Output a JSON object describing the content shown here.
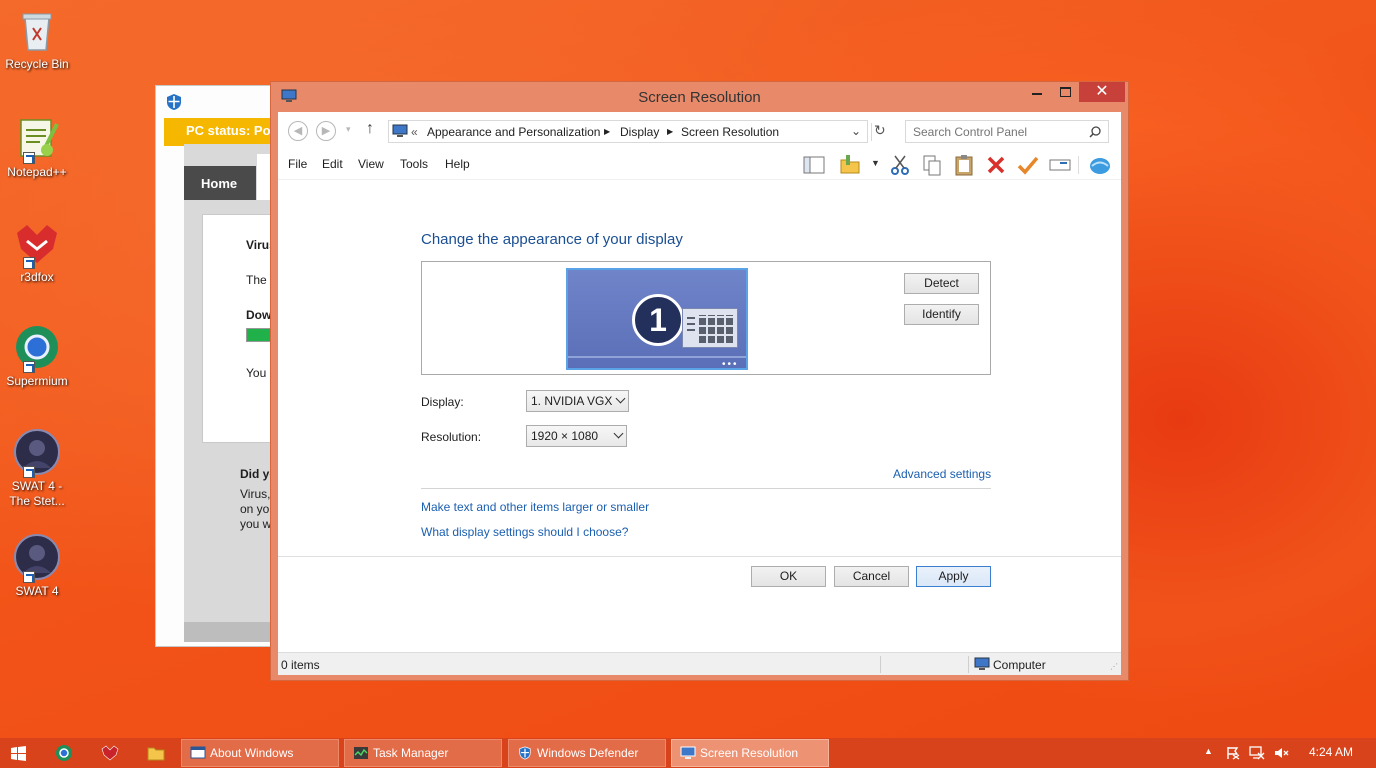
{
  "desktop": {
    "icons": [
      {
        "label": "Recycle Bin",
        "icon": "recycle-bin-icon"
      },
      {
        "label": "Notepad++",
        "icon": "notepad-plus-plus-icon"
      },
      {
        "label": "r3dfox",
        "icon": "r3dfox-icon"
      },
      {
        "label": "Supermium",
        "icon": "supermium-icon"
      },
      {
        "label": "SWAT 4 - The Stet...",
        "label_line1": "SWAT 4 -",
        "label_line2": "The Stet...",
        "icon": "swat4-icon"
      },
      {
        "label": "SWAT 4",
        "icon": "swat4-icon"
      }
    ]
  },
  "defender": {
    "status": "PC status: Pot",
    "home_tab": "Home",
    "texts": [
      "Virus",
      "The",
      "Dow",
      "You",
      "Did yo",
      "Virus,",
      "on yo",
      "you w"
    ]
  },
  "window": {
    "title": "Screen Resolution",
    "close_glyph": "✕",
    "address": {
      "prefix": "«",
      "crumbs": [
        "Appearance and Personalization",
        "Display",
        "Screen Resolution"
      ]
    },
    "search_placeholder": "Search Control Panel",
    "menu": [
      "File",
      "Edit",
      "View",
      "Tools",
      "Help"
    ],
    "heading": "Change the appearance of your display",
    "monitor_number": "1",
    "detect_label": "Detect",
    "identify_label": "Identify",
    "display_label": "Display:",
    "display_value": "1. NVIDIA VGX",
    "resolution_label": "Resolution:",
    "resolution_value": "1920 × 1080",
    "advanced_link": "Advanced settings",
    "link_text_size": "Make text and other items larger or smaller",
    "link_display_settings": "What display settings should I choose?",
    "ok_label": "OK",
    "cancel_label": "Cancel",
    "apply_label": "Apply",
    "status_items": "0 items",
    "status_computer": "Computer"
  },
  "taskbar": {
    "tasks": [
      "About Windows",
      "Task Manager",
      "Windows Defender",
      "Screen Resolution"
    ],
    "active_task": "Screen Resolution",
    "clock": "4:24 AM"
  },
  "colors": {
    "accent": "#f24d14",
    "window_frame": "#e8896a",
    "taskbar": "#d8431b",
    "link": "#1b5fb0",
    "heading": "#1b4f93",
    "close_button": "#c7413a"
  }
}
